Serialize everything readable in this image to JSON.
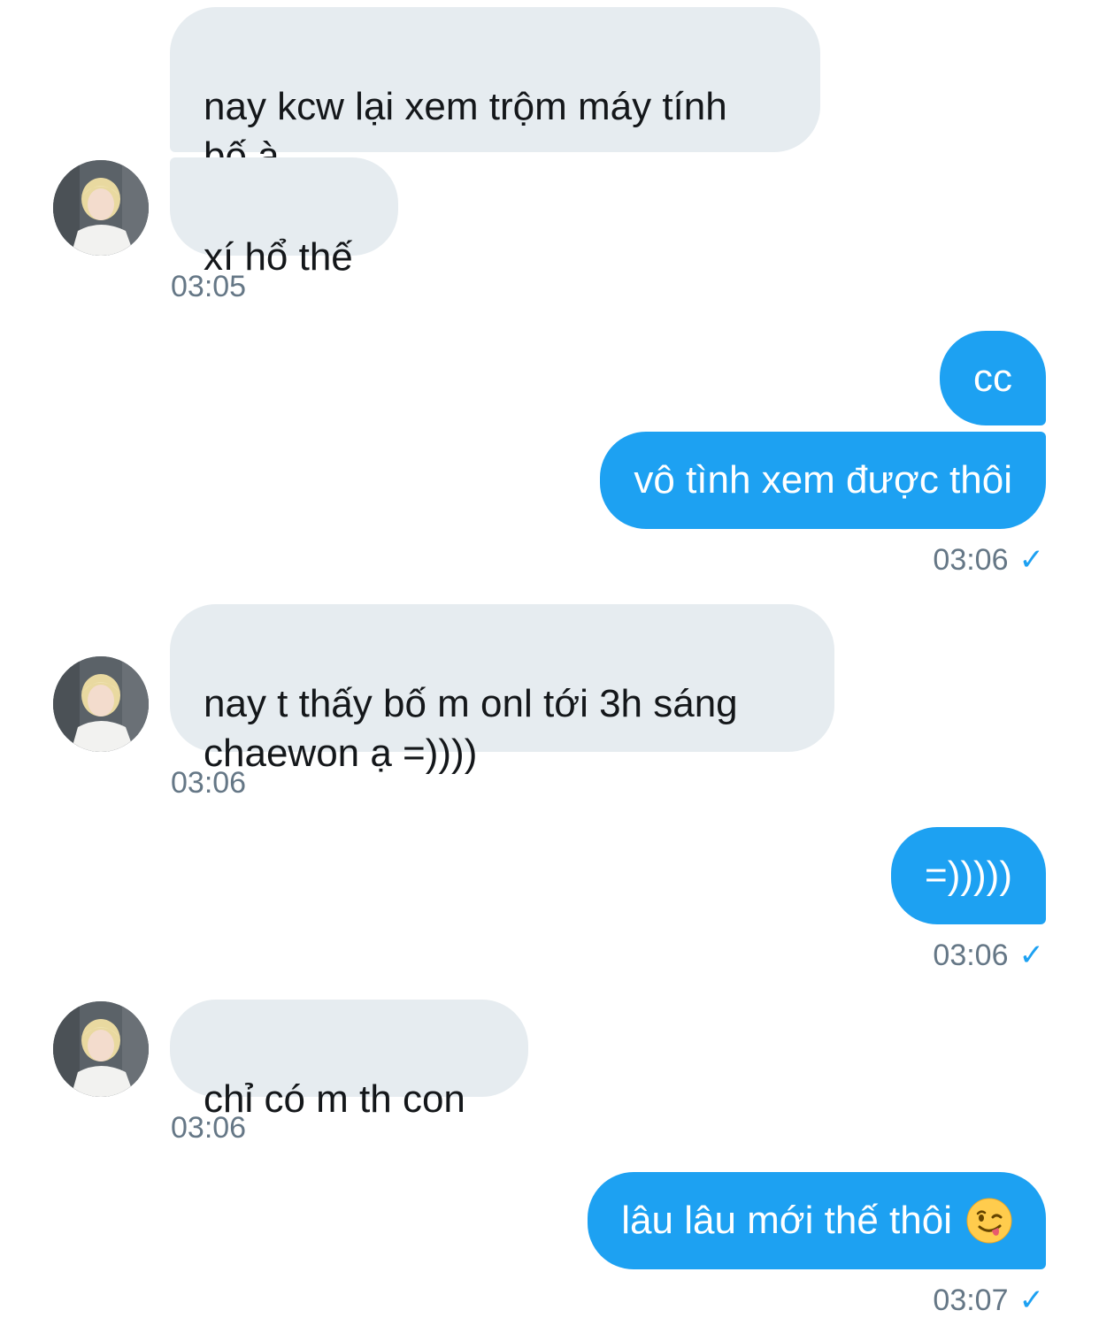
{
  "conversation": {
    "messages": [
      {
        "sender": "other",
        "text": "nay kcw lại xem trộm máy tính\nbố à"
      },
      {
        "sender": "other",
        "text": "xí hổ thế",
        "time": "03:05"
      },
      {
        "sender": "me",
        "text": "cc"
      },
      {
        "sender": "me",
        "text": "vô tình xem được thôi",
        "time": "03:06"
      },
      {
        "sender": "other",
        "text": "nay t thấy bố m onl tới 3h sáng\nchaewon ạ =))))",
        "time": "03:06"
      },
      {
        "sender": "me",
        "text": "=)))))",
        "time": "03:06"
      },
      {
        "sender": "other",
        "text": "chỉ có m th con",
        "time": "03:06"
      },
      {
        "sender": "me",
        "text": "lâu lâu mới thế thôi",
        "emoji": "winking-face-with-tongue",
        "time": "03:07"
      }
    ],
    "read_receipt_icon": "checkmark-icon",
    "read_receipt_glyph": "✓",
    "colors": {
      "incoming_bubble": "#e6ecf0",
      "outgoing_bubble": "#1da1f2",
      "timestamp": "#657786",
      "checkmark": "#1da1f2"
    }
  }
}
